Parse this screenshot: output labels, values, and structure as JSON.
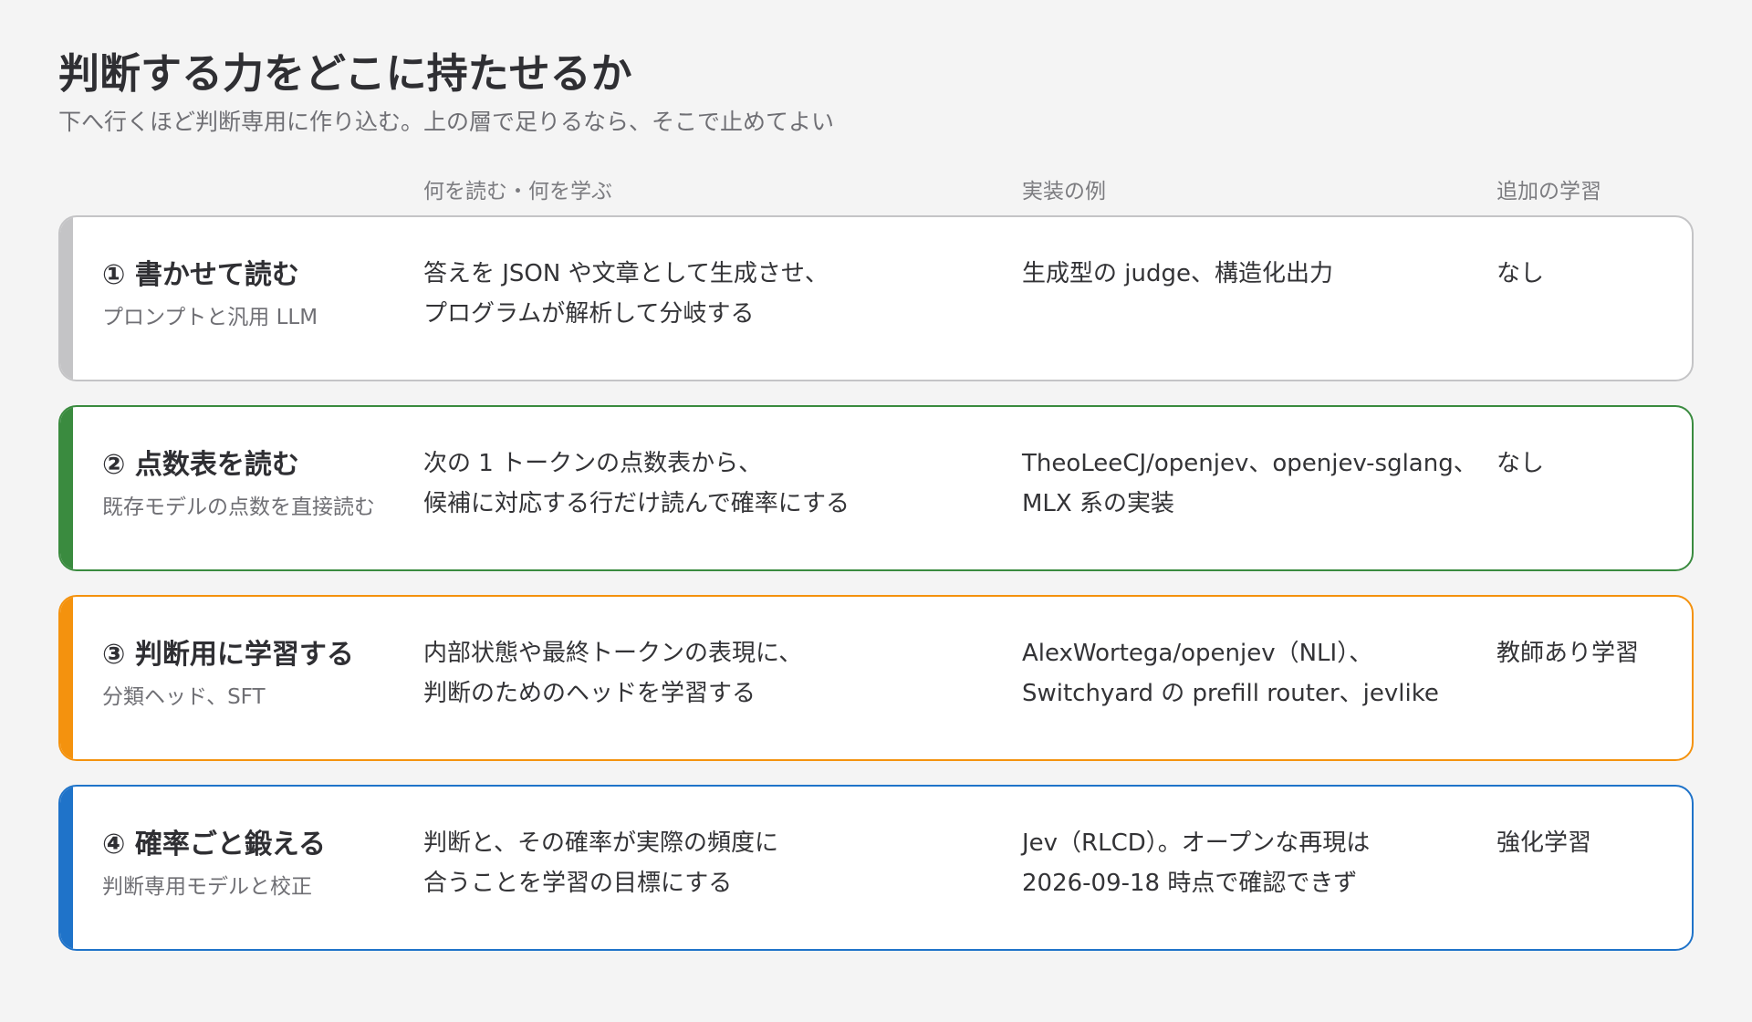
{
  "title": "判断する力をどこに持たせるか",
  "subtitle": "下へ行くほど判断専用に作り込む。上の層で足りるなら、そこで止めてよい",
  "columns": {
    "read": "何を読む・何を学ぶ",
    "impl": "実装の例",
    "extra": "追加の学習"
  },
  "rows": [
    {
      "title": "① 書かせて読む",
      "sub": "プロンプトと汎用 LLM",
      "read": [
        "答えを JSON や文章として生成させ、",
        "プログラムが解析して分岐する"
      ],
      "impl": [
        "生成型の judge、構造化出力"
      ],
      "extra": "なし",
      "color": "#c4c4c6"
    },
    {
      "title": "② 点数表を読む",
      "sub": "既存モデルの点数を直接読む",
      "read": [
        "次の 1 トークンの点数表から、",
        "候補に対応する行だけ読んで確率にする"
      ],
      "impl": [
        "TheoLeeCJ/openjev、openjev-sglang、",
        "MLX 系の実装"
      ],
      "extra": "なし",
      "color": "#3a8b3f"
    },
    {
      "title": "③ 判断用に学習する",
      "sub": "分類ヘッド、SFT",
      "read": [
        "内部状態や最終トークンの表現に、",
        "判断のためのヘッドを学習する"
      ],
      "impl": [
        "AlexWortega/openjev（NLI）、",
        "Switchyard の prefill router、jevlike"
      ],
      "extra": "教師あり学習",
      "color": "#f4920e"
    },
    {
      "title": "④ 確率ごと鍛える",
      "sub": "判断専用モデルと校正",
      "read": [
        "判断と、その確率が実際の頻度に",
        "合うことを学習の目標にする"
      ],
      "impl": [
        "Jev（RLCD）。オープンな再現は",
        "2026-09-18 時点で確認できず"
      ],
      "extra": "強化学習",
      "color": "#1f73c9"
    }
  ]
}
